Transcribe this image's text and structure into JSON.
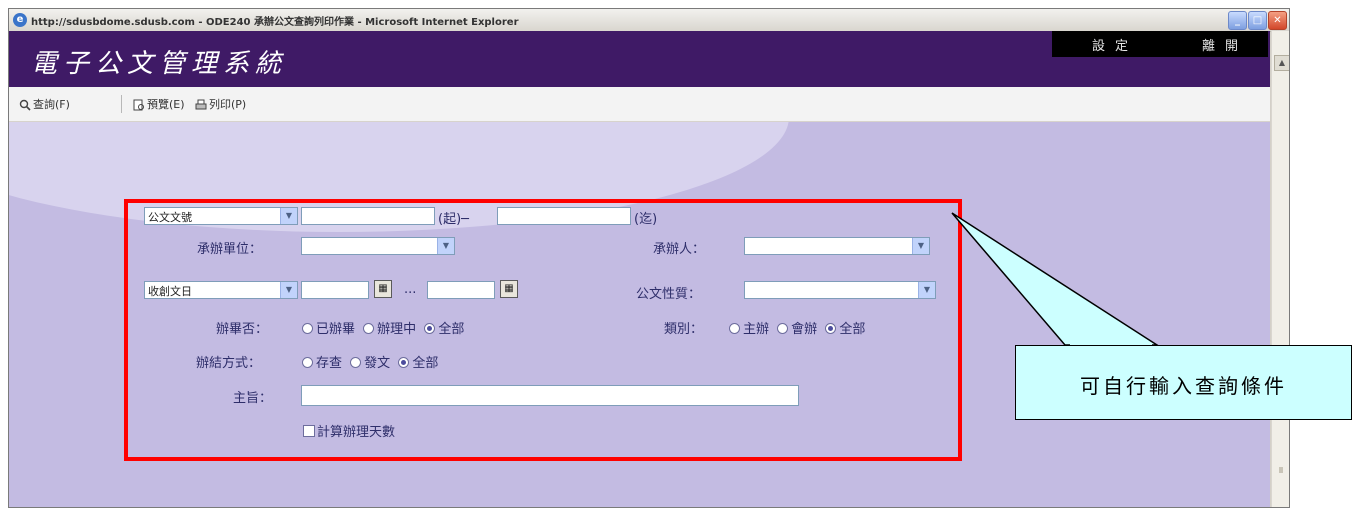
{
  "window": {
    "title": "http://sdusbdome.sdusb.com - ODE240 承辦公文查詢列印作業 - Microsoft Internet Explorer",
    "minimize": "_",
    "maximize": "□",
    "close": "✕"
  },
  "header": {
    "app_title": "電子公文管理系統",
    "settings_link": "設定",
    "logout_link": "離開"
  },
  "toolbar": {
    "query_label": "查詢(F)",
    "preview_label": "預覽(E)",
    "print_label": "列印(P)"
  },
  "form": {
    "doc_no_select": "公文文號",
    "doc_no_from_suffix": "(起)─",
    "doc_no_to_suffix": "(迄)",
    "unit_label": "承辦單位：",
    "person_label": "承辦人：",
    "date_select": "收創文日",
    "date_separator": "...",
    "nature_label": "公文性質：",
    "closed_label": "辦畢否：",
    "closed_options": [
      "已辦畢",
      "辦理中",
      "全部"
    ],
    "closed_selected": 2,
    "category_label": "類別：",
    "category_options": [
      "主辦",
      "會辦",
      "全部"
    ],
    "category_selected": 2,
    "method_label": "辦結方式：",
    "method_options": [
      "存查",
      "發文",
      "全部"
    ],
    "method_selected": 2,
    "subject_label": "主旨：",
    "calc_days_label": "計算辦理天數"
  },
  "callout": {
    "text": "可自行輸入查詢條件"
  },
  "colors": {
    "header_bg": "#3f1a66",
    "form_bg": "#c3bbe2",
    "highlight_frame": "#ff0000",
    "callout_bg": "#ccffff"
  }
}
